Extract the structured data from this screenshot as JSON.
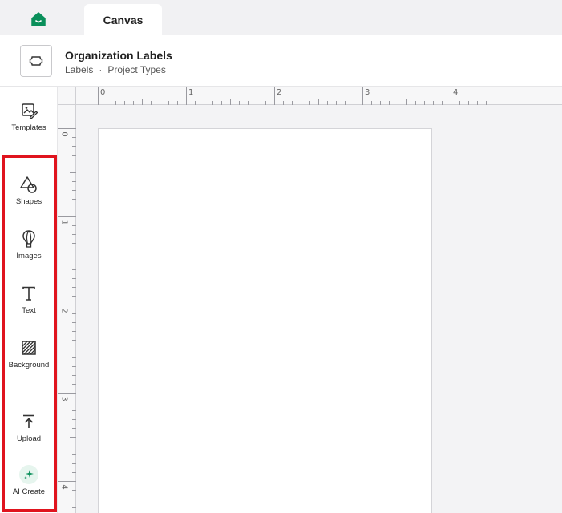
{
  "tabs": [
    {
      "label": "Canvas",
      "active": true
    }
  ],
  "document": {
    "title": "Organization Labels",
    "breadcrumb": [
      "Labels",
      "Project Types"
    ],
    "separator": "·"
  },
  "sidebar": {
    "items": [
      {
        "label": "Templates",
        "icon": "templates-icon"
      },
      {
        "label": "Shapes",
        "icon": "shapes-icon"
      },
      {
        "label": "Images",
        "icon": "images-icon"
      },
      {
        "label": "Text",
        "icon": "text-icon"
      },
      {
        "label": "Background",
        "icon": "background-icon"
      },
      {
        "label": "Upload",
        "icon": "upload-icon"
      },
      {
        "label": "AI Create",
        "icon": "ai-sparkle-icon"
      }
    ]
  },
  "rulers": {
    "horizontal": [
      "0",
      "1",
      "2",
      "3",
      "4"
    ],
    "vertical": [
      "0",
      "1",
      "2",
      "3",
      "4"
    ]
  },
  "colors": {
    "brand": "#0a8f5a",
    "highlight": "#e0141e"
  }
}
